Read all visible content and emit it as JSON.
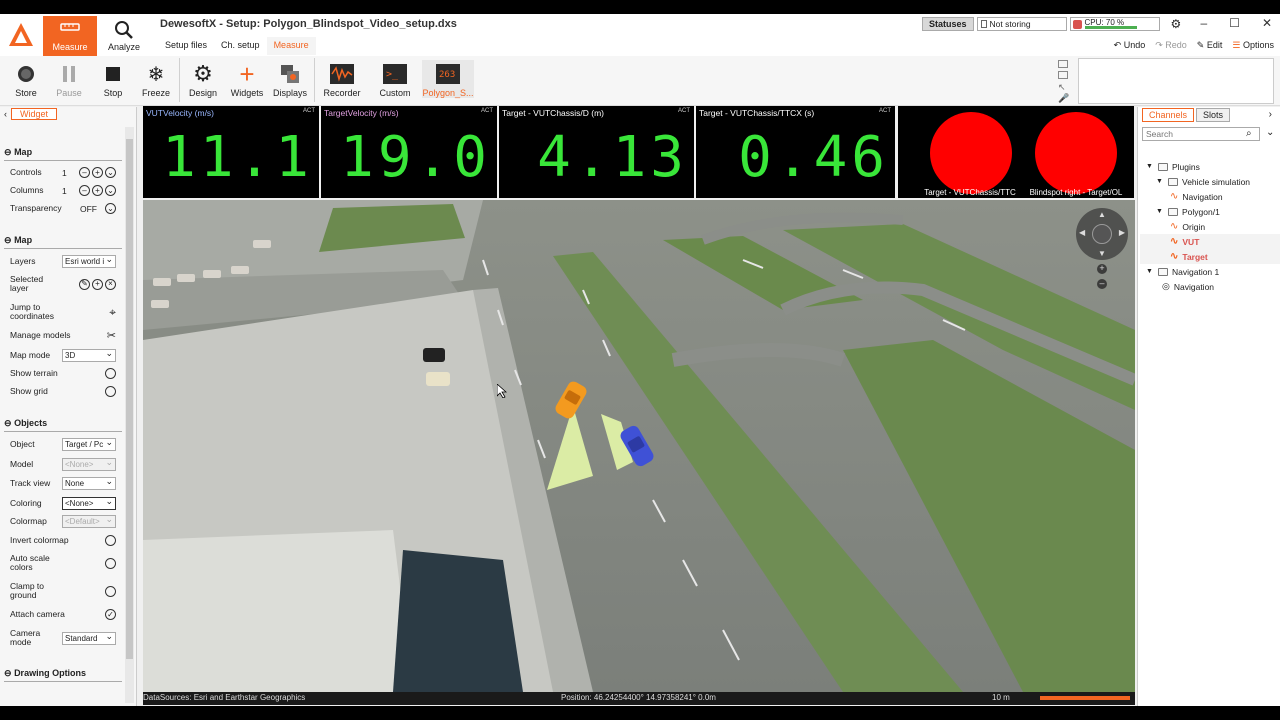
{
  "app": {
    "title": "DewesoftX - Setup: Polygon_Blindspot_Video_setup.dxs",
    "measure_label": "Measure",
    "analyze_label": "Analyze",
    "subtabs": [
      "Setup files",
      "Ch. setup",
      "Measure"
    ],
    "statuses_label": "Statuses",
    "storing_label": "Not storing",
    "cpu_label": "CPU: 70 %",
    "cpu_pct": 70,
    "actions": {
      "undo": "Undo",
      "redo": "Redo",
      "edit": "Edit",
      "options": "Options"
    }
  },
  "toolbar": {
    "store": "Store",
    "pause": "Pause",
    "stop": "Stop",
    "freeze": "Freeze",
    "design": "Design",
    "widgets": "Widgets",
    "displays": "Displays",
    "recorder": "Recorder",
    "custom": "Custom",
    "polygon": "Polygon_S..."
  },
  "left": {
    "tab": "Widget",
    "sec_map1": "Map",
    "controls_label": "Controls",
    "controls_val": "1",
    "columns_label": "Columns",
    "columns_val": "1",
    "transparency_label": "Transparency",
    "transparency_val": "OFF",
    "sec_map2": "Map",
    "layers_label": "Layers",
    "layers_val": "Esri world i",
    "selected_layer_label": "Selected layer",
    "jump_label": "Jump to coordinates",
    "manage_label": "Manage models",
    "mapmode_label": "Map mode",
    "mapmode_val": "3D",
    "terrain_label": "Show terrain",
    "grid_label": "Show grid",
    "sec_objects": "Objects",
    "object_label": "Object",
    "object_val": "Target / Pc",
    "model_label": "Model",
    "model_val": "<None>",
    "trackview_label": "Track view",
    "trackview_val": "None",
    "coloring_label": "Coloring",
    "coloring_val": "<None>",
    "colormap_label": "Colormap",
    "colormap_val": "<Default>",
    "invert_label": "Invert colormap",
    "autoscale_label": "Auto scale colors",
    "clamp_label": "Clamp to ground",
    "attach_label": "Attach camera",
    "cammode_label": "Camera mode",
    "cammode_val": "Standard",
    "sec_drawing": "Drawing Options"
  },
  "meters": [
    {
      "title": "VUTVelocity (m/s)",
      "value": "11.1",
      "act": "ACT"
    },
    {
      "title": "TargetVelocity (m/s)",
      "value": "19.0",
      "act": "ACT"
    },
    {
      "title": "Target - VUTChassis/D (m)",
      "value": "4.13",
      "act": "ACT"
    },
    {
      "title": "Target - VUTChassis/TTCX (s)",
      "value": "0.46",
      "act": "ACT"
    }
  ],
  "lamps": [
    {
      "label": "Target - VUTChassis/TTC",
      "color": "#ff0000"
    },
    {
      "label": "Blindspot right - Target/OL",
      "color": "#ff0000"
    }
  ],
  "map": {
    "datasource": "DataSources: Esri and Earthstar Geographics",
    "position": "Position: 46.24254400° 14.97358241° 0.0m",
    "scale": "10 m"
  },
  "right": {
    "tabs": [
      "Channels",
      "Slots"
    ],
    "search_placeholder": "Search",
    "tree": {
      "plugins": "Plugins",
      "vehicle_sim": "Vehicle simulation",
      "navigation": "Navigation",
      "polygon": "Polygon/1",
      "origin": "Origin",
      "vut": "VUT",
      "target": "Target",
      "navigation1": "Navigation 1",
      "navigation_ch": "Navigation"
    }
  },
  "colors": {
    "accent": "#f26522",
    "meter_digits": "#39e639",
    "lamp_on": "#ff0000"
  }
}
